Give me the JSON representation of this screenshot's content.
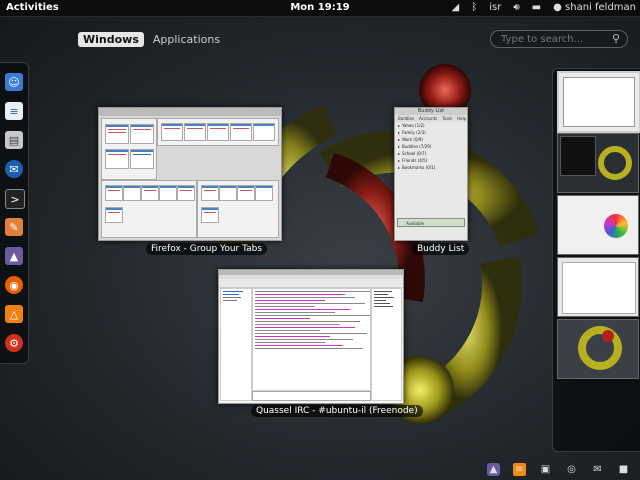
{
  "top_bar": {
    "activities": "Activities",
    "clock": "Mon 19:19",
    "keyboard_layout": "isr",
    "user": "shani feldman",
    "icons": [
      "wifi-icon",
      "bluetooth-icon",
      "keyboard-icon",
      "volume-icon",
      "battery-icon",
      "user-icon"
    ]
  },
  "overview": {
    "tabs": [
      "Windows",
      "Applications"
    ],
    "active_tab": "Windows",
    "search_placeholder": "Type to search..."
  },
  "dash": {
    "items": [
      "empathy-icon",
      "document-icon",
      "file-manager-icon",
      "thunderbird-icon",
      "terminal-icon",
      "scribus-icon",
      "inkscape-icon",
      "firefox-icon",
      "vlc-icon",
      "settings-icon"
    ]
  },
  "windows": [
    {
      "id": "firefox",
      "label": "Firefox - Group Your Tabs"
    },
    {
      "id": "buddy",
      "label": "Buddy List"
    },
    {
      "id": "quassel",
      "label": "Quassel IRC - #ubuntu-il (Freenode)"
    }
  ],
  "buddy_list": {
    "title": "Buddy List",
    "menu": [
      "Buddies",
      "Accounts",
      "Tools",
      "Help"
    ],
    "groups": [
      "Yahoo (1/2)",
      "Family (2/3)",
      "Work (0/9)",
      "Buddies (7/29)",
      "School (0/7)",
      "Friends (4/5)",
      "Bookmarks (0/1)"
    ],
    "status": "Available"
  },
  "workspaces": {
    "count": 5,
    "active_index": 0
  },
  "tray": [
    "inkscape-icon",
    "document-icon",
    "screen-icon",
    "wireless-icon",
    "mail-icon",
    "chat-icon"
  ],
  "colors": {
    "background": "#22272c",
    "panel": "#0c0c0c",
    "active_tab_bg": "#e6e6e6",
    "firefox_orange": "#e66000",
    "ring_red": "#b0221c",
    "ring_yellow": "#b8b020"
  }
}
